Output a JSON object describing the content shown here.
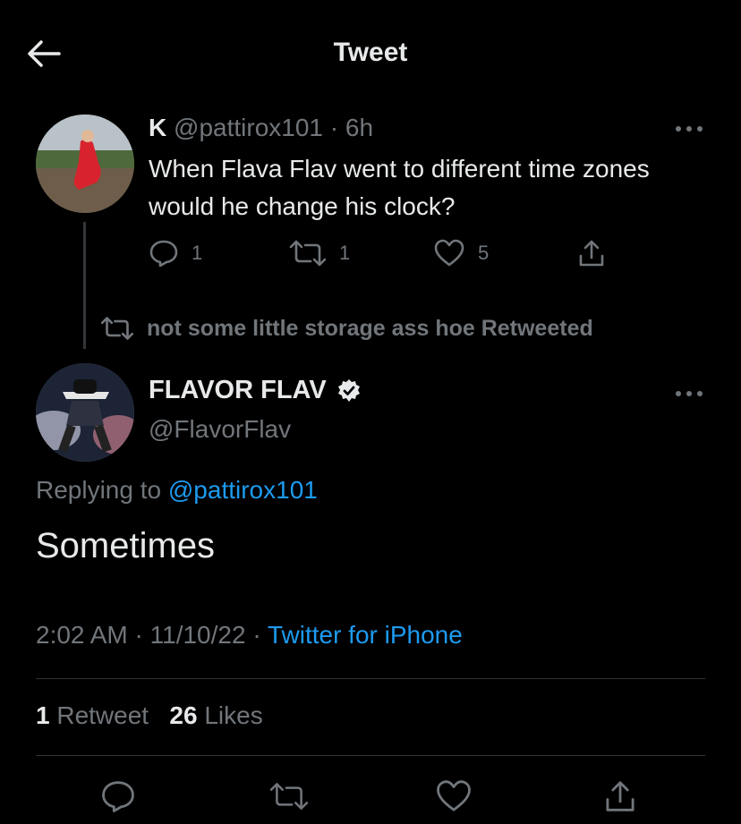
{
  "header": {
    "title": "Tweet",
    "back_icon": "arrow-left-icon"
  },
  "parent_tweet": {
    "display_name": "K",
    "handle": "@pattirox101",
    "time": "6h",
    "separator": "·",
    "text": "When Flava Flav went to different time zones would he change his clock?",
    "replies": "1",
    "retweets": "1",
    "likes": "5"
  },
  "retweet_context": {
    "text": "not some little storage ass hoe Retweeted"
  },
  "main_tweet": {
    "display_name": "FLAVOR FLAV",
    "handle": "@FlavorFlav",
    "verified": true,
    "replying_prefix": "Replying to",
    "replying_to": "@pattirox101",
    "text": "Sometimes",
    "time": "2:02 AM",
    "date": "11/10/22",
    "separator": "·",
    "source": "Twitter for iPhone",
    "retweet_count": "1",
    "retweet_label": "Retweet",
    "like_count": "26",
    "like_label": "Likes"
  },
  "colors": {
    "background": "#000000",
    "text_primary": "#e7e9ea",
    "text_secondary": "#71767b",
    "accent": "#1d9bf0",
    "divider": "#2f3336"
  }
}
